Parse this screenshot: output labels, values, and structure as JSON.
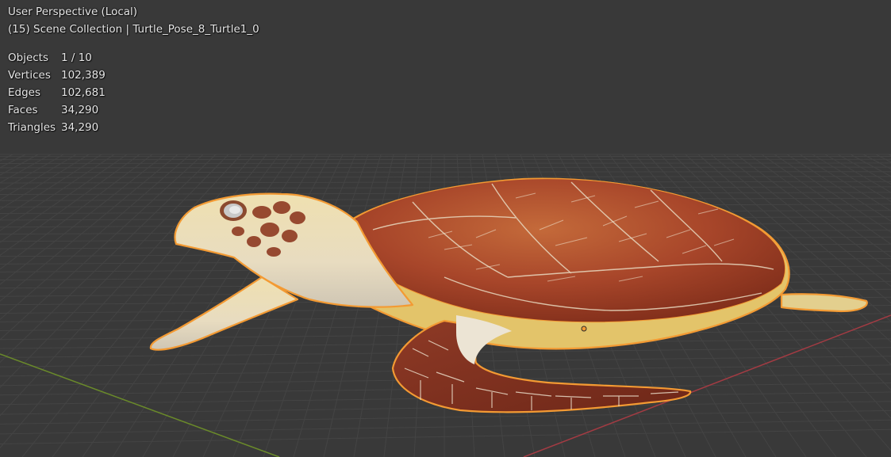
{
  "viewport": {
    "view_name": "User Perspective (Local)",
    "collection_line": "(15) Scene Collection | Turtle_Pose_8_Turtle1_0"
  },
  "stats": [
    {
      "label": "Objects",
      "value": "1 / 10"
    },
    {
      "label": "Vertices",
      "value": "102,389"
    },
    {
      "label": "Edges",
      "value": "102,681"
    },
    {
      "label": "Faces",
      "value": "34,290"
    },
    {
      "label": "Triangles",
      "value": "34,290"
    }
  ],
  "colors": {
    "background": "#393939",
    "grid": "#444444",
    "x_axis": "#a33b43",
    "y_axis": "#6a8a2a",
    "selection_outline": "#f39a33",
    "shell": "#a9472a",
    "skin": "#ead8a6"
  },
  "icons": [
    "origin-dot-icon"
  ]
}
